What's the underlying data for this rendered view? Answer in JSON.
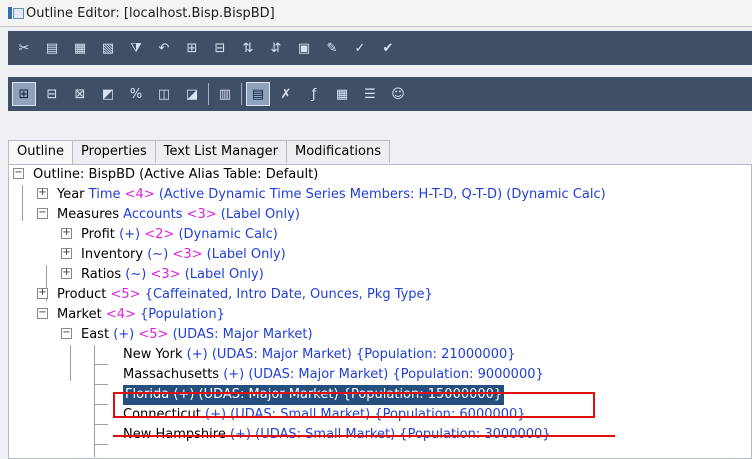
{
  "window": {
    "title": "Outline Editor: [localhost.Bisp.BispBD]"
  },
  "toolbar1": {
    "icons": [
      "cut-icon",
      "copy-icon",
      "paste-icon",
      "paste-special-icon",
      "filter-icon",
      "undo-icon",
      "add-child-icon",
      "add-sibling-icon",
      "sort-icon",
      "restructure-icon",
      "save-icon",
      "edit-icon",
      "verify-icon",
      "verify-all-icon"
    ]
  },
  "toolbar2": {
    "icons": [
      "expand-icon",
      "collapse-icon",
      "close-icon",
      "minimize-icon",
      "percent-icon",
      "restore-icon",
      "maximize-icon",
      "grid-icon",
      "properties-icon",
      "delete-icon",
      "formula-icon",
      "table-icon",
      "list-icon",
      "users-icon"
    ]
  },
  "tabs": [
    "Outline",
    "Properties",
    "Text List Manager",
    "Modifications"
  ],
  "outline": {
    "root": "Outline: BispBD (Active Alias Table: Default)",
    "year": {
      "name": "Year",
      "alias": "Time",
      "count": "<4>",
      "props": "(Active Dynamic Time Series Members: H-T-D, Q-T-D) (Dynamic Calc)"
    },
    "measures": {
      "name": "Measures",
      "alias": "Accounts",
      "count": "<3>",
      "props": "(Label Only)"
    },
    "profit": {
      "name": "Profit",
      "op": "(+)",
      "count": "<2>",
      "props": "(Dynamic Calc)"
    },
    "inventory": {
      "name": "Inventory",
      "op": "(~)",
      "count": "<3>",
      "props": "(Label Only)"
    },
    "ratios": {
      "name": "Ratios",
      "op": "(~)",
      "count": "<3>",
      "props": "(Label Only)"
    },
    "product": {
      "name": "Product",
      "count": "<5>",
      "props": "{Caffeinated, Intro Date, Ounces, Pkg Type}"
    },
    "market": {
      "name": "Market",
      "count": "<4>",
      "props": "{Population}"
    },
    "east": {
      "name": "East",
      "op": "(+)",
      "count": "<5>",
      "props": "(UDAS: Major Market)"
    },
    "new_york": {
      "name": "New York",
      "props": "(+) (UDAS: Major Market) {Population: 21000000}"
    },
    "massachusetts": {
      "name": "Massachusetts",
      "props": "(+) (UDAS: Major Market) {Population: 9000000}"
    },
    "florida": {
      "name": "Florida",
      "props": "(+) (UDAS: Major Market) {Population: 15000000}"
    },
    "connecticut": {
      "name": "Connecticut",
      "props": "(+) (UDAS: Small Market) {Population: 6000000}"
    },
    "new_hampshire": {
      "name": "New Hampshire",
      "props": "(+) (UDAS: Small Market) {Population: 3000000}"
    }
  },
  "colors": {
    "alias": "#1f3fd6",
    "count": "#e020e0",
    "selection": "#244f7f",
    "highlight": "#e01010"
  }
}
